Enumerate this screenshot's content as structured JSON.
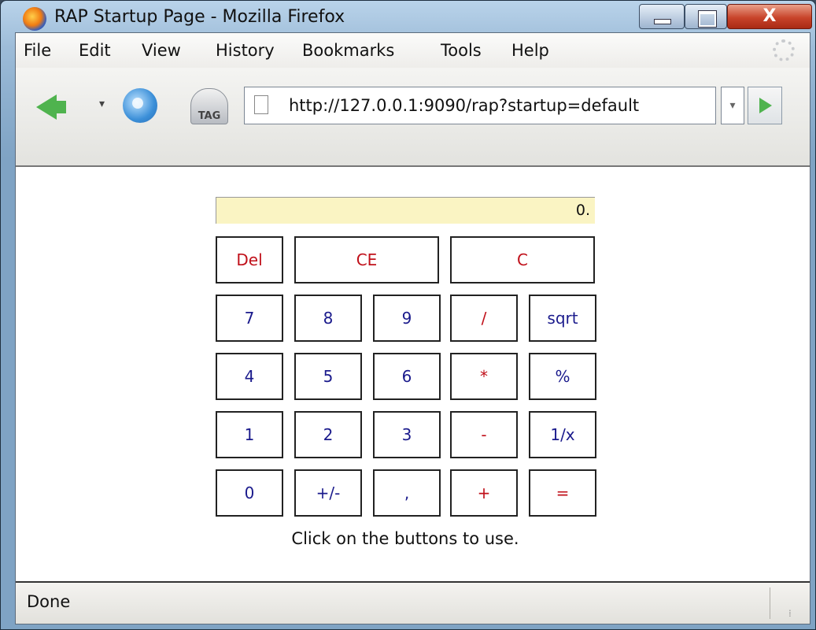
{
  "window": {
    "title": "RAP Startup Page - Mozilla Firefox",
    "close_symbol": "X",
    "icons": [
      "firefox-icon",
      "minimize-icon",
      "maximize-icon",
      "close-icon"
    ]
  },
  "menu": {
    "items": [
      "File",
      "Edit",
      "View",
      "History",
      "Bookmarks",
      "Tools",
      "Help"
    ]
  },
  "toolbar": {
    "url": "http://127.0.0.1:9090/rap?startup=default",
    "tag_label": "TAG",
    "dropdown_symbol": "▾",
    "icons": [
      "back-arrow-icon",
      "reload-icon",
      "tag-icon",
      "page-icon",
      "go-arrow-icon",
      "throbber-icon"
    ]
  },
  "calculator": {
    "display": "0.",
    "rows": [
      [
        {
          "label": "Del",
          "color": "#c0101a"
        },
        {
          "label": "CE",
          "color": "#c0101a"
        },
        {
          "label": "C",
          "color": "#c0101a"
        }
      ],
      [
        {
          "label": "7"
        },
        {
          "label": "8"
        },
        {
          "label": "9"
        },
        {
          "label": "/",
          "color": "#c0101a"
        },
        {
          "label": "sqrt"
        }
      ],
      [
        {
          "label": "4"
        },
        {
          "label": "5"
        },
        {
          "label": "6"
        },
        {
          "label": "*",
          "color": "#c0101a"
        },
        {
          "label": "%"
        }
      ],
      [
        {
          "label": "1"
        },
        {
          "label": "2"
        },
        {
          "label": "3"
        },
        {
          "label": "-",
          "color": "#c0101a"
        },
        {
          "label": "1/x"
        }
      ],
      [
        {
          "label": "0"
        },
        {
          "label": "+/-"
        },
        {
          "label": ","
        },
        {
          "label": "+",
          "color": "#c0101a"
        },
        {
          "label": "=",
          "color": "#c0101a"
        }
      ]
    ],
    "hint": "Click on the buttons to use."
  },
  "status": {
    "text": "Done"
  },
  "colors": {
    "operator": "#c0101a",
    "digit": "#1a1a8c",
    "display_bg": "#faf4c3"
  }
}
